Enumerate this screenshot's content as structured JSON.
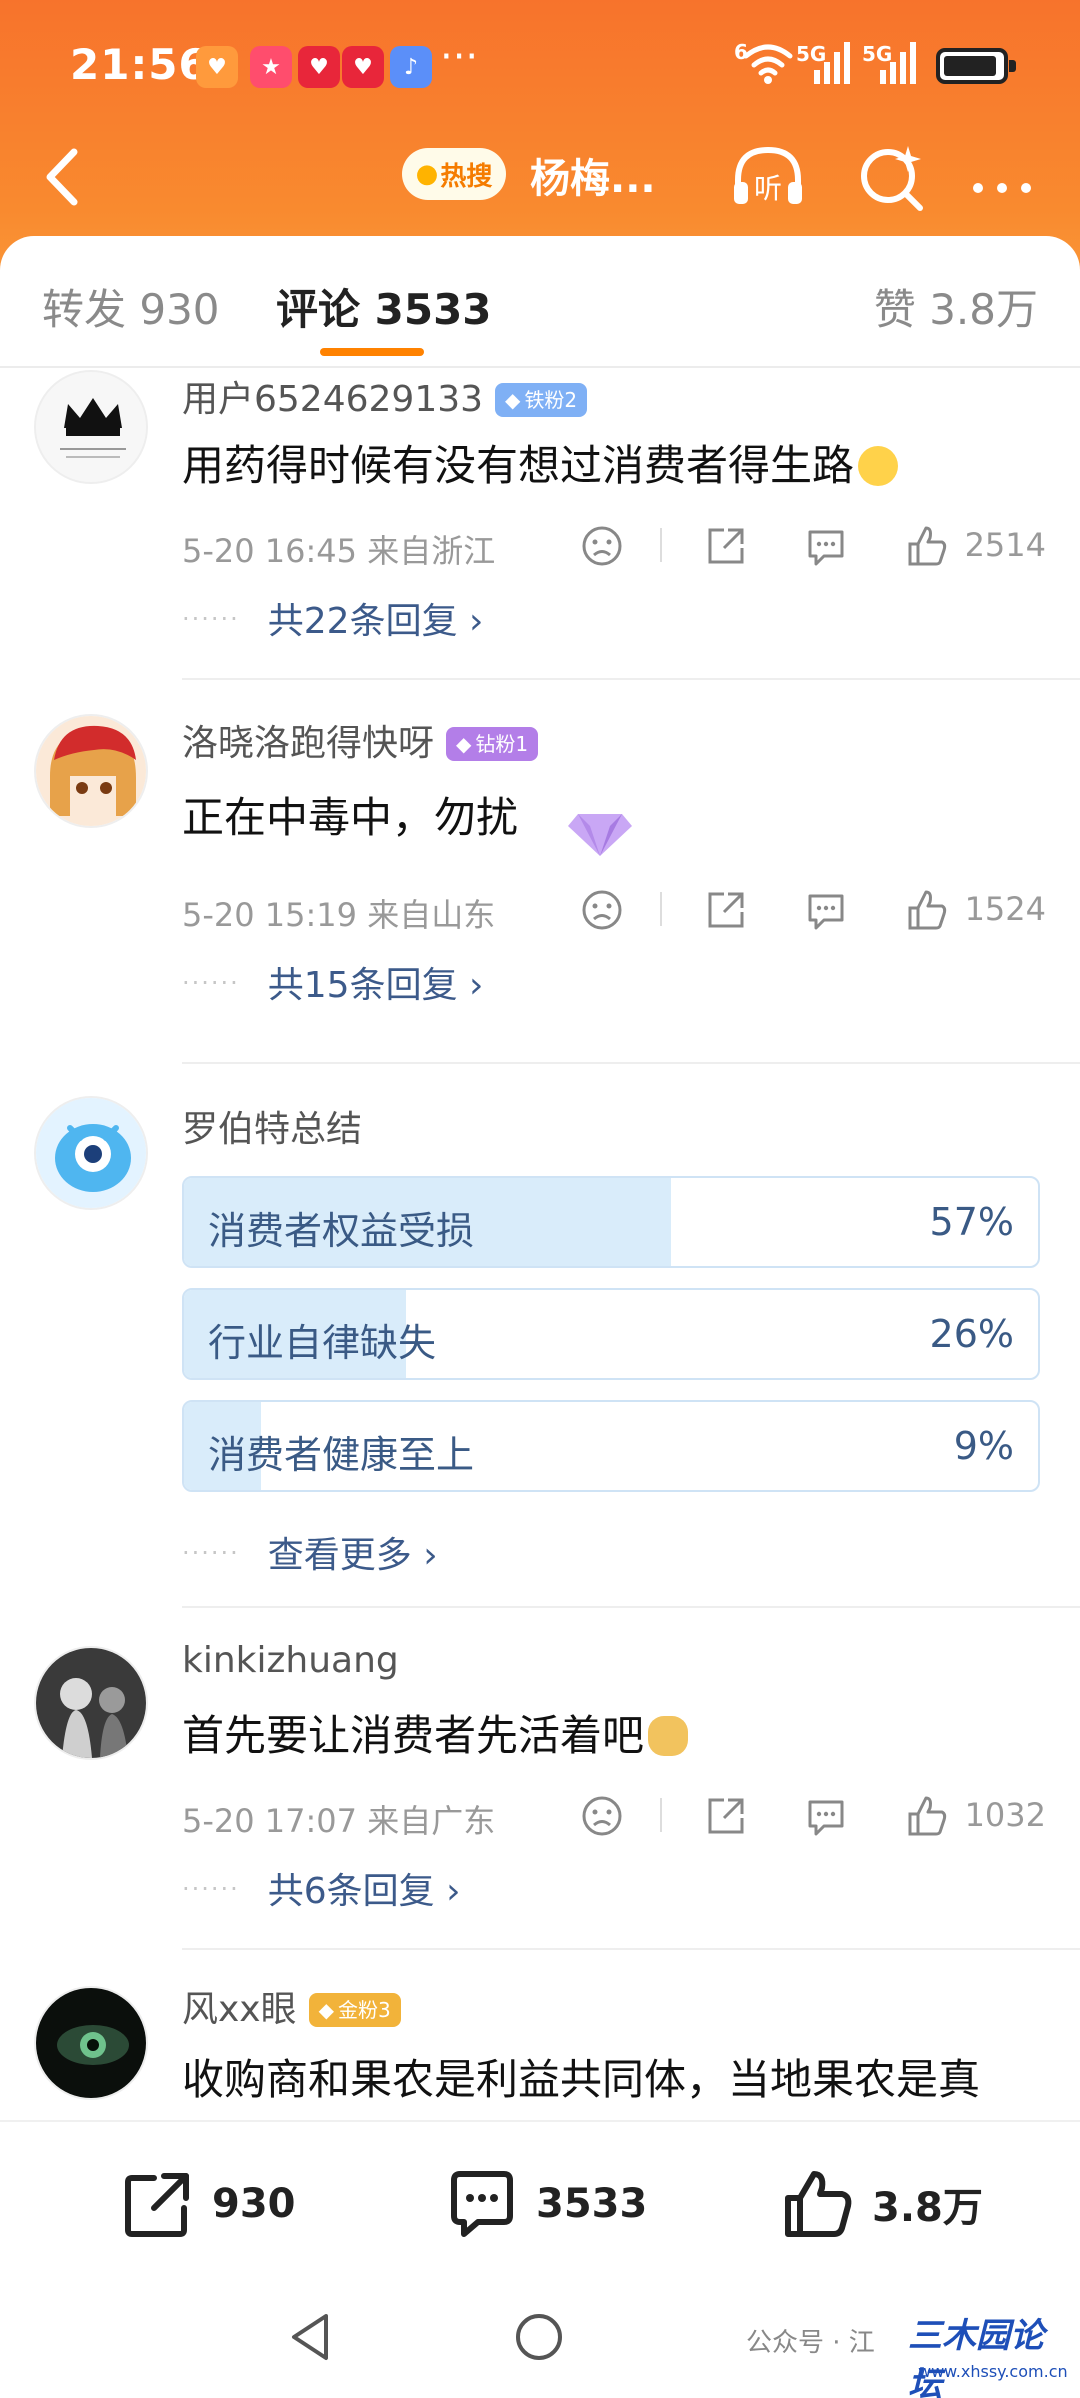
{
  "status_bar": {
    "time": "21:56",
    "network_1": "5G",
    "network_2": "5G",
    "wifi_sub": "6"
  },
  "nav": {
    "hot_label": "热搜",
    "title": "杨梅...",
    "listen_icon": "headphones-listen-icon",
    "search_icon": "sparkle-search-icon"
  },
  "tabs": [
    {
      "label": "转发 930"
    },
    {
      "label": "评论 3533"
    },
    {
      "label": "赞 3.8万"
    }
  ],
  "comments": [
    {
      "user": "用户6524629133",
      "badge": "铁粉2",
      "text": "用药得时候有没有想过消费者得生路",
      "time": "5-20 16:45",
      "location": "来自浙江",
      "likes": "2514",
      "replies": "共22条回复 ›"
    },
    {
      "user": "洛晓洛跑得快呀",
      "badge": "钻粉1",
      "text": "正在中毒中，勿扰",
      "time": "5-20 15:19",
      "location": "来自山东",
      "likes": "1524",
      "replies": "共15条回复 ›"
    },
    {
      "user": "kinkizhuang",
      "text": "首先要让消费者先活着吧",
      "time": "5-20 17:07",
      "location": "来自广东",
      "likes": "1032",
      "replies": "共6条回复 ›"
    },
    {
      "user": "风xx眼",
      "badge": "金粉3",
      "text": "收购商和果农是利益共同体，当地果农是真"
    }
  ],
  "poll": {
    "user": "罗伯特总结",
    "options": [
      {
        "label": "消费者权益受损",
        "pct_text": "57%",
        "pct": 57
      },
      {
        "label": "行业自律缺失",
        "pct_text": "26%",
        "pct": 26
      },
      {
        "label": "消费者健康至上",
        "pct_text": "9%",
        "pct": 9
      }
    ],
    "more": "查看更多 ›"
  },
  "actions": {
    "repost": "930",
    "comment": "3533",
    "like": "3.8万"
  },
  "watermark": {
    "label": "公众号 · 江",
    "logo": "三木园论坛",
    "url": "www.xhssy.com.cn"
  },
  "colors": {
    "brand_orange": "#f7732c",
    "tab_underline": "#ff8200",
    "reply_link": "#3c5a8a",
    "poll_fill": "#d9ecfa"
  }
}
